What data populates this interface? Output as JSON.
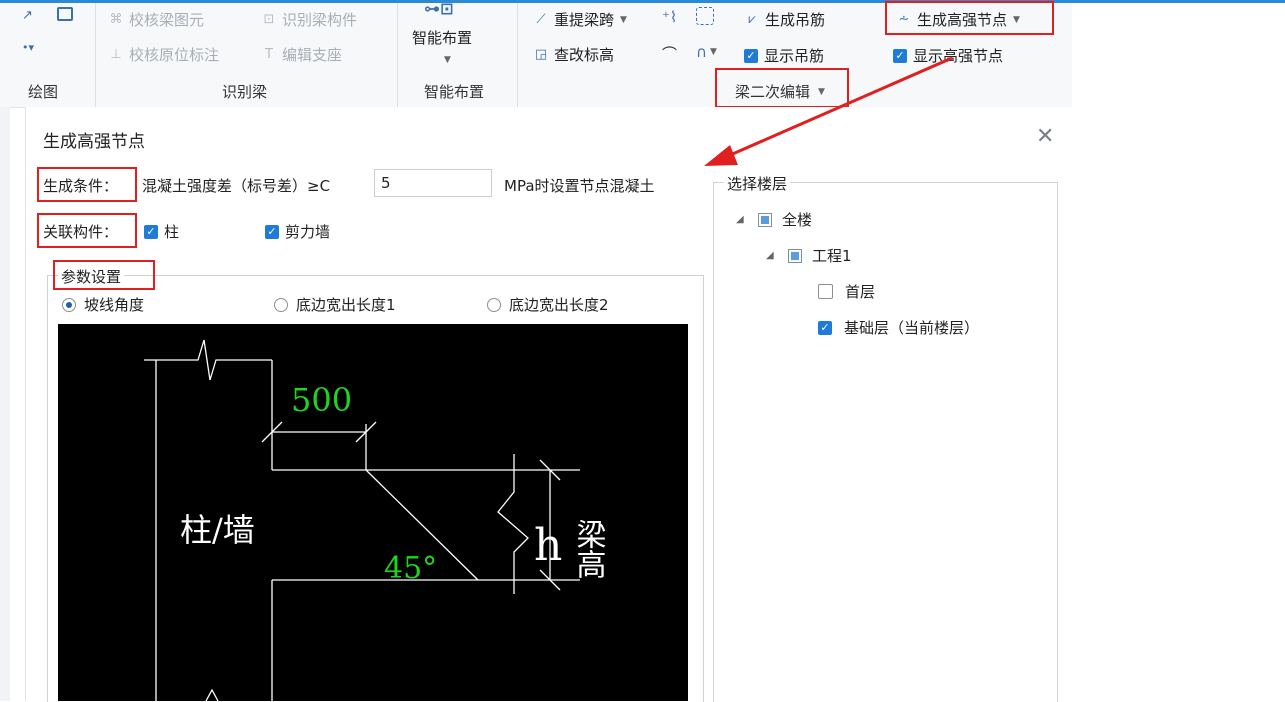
{
  "ribbon": {
    "groups": {
      "draw": "绘图",
      "recognize_beam": "识别梁",
      "smart_layout": "智能布置",
      "beam_secondary_edit": "梁二次编辑"
    },
    "items": {
      "check_beam_elements": "校核梁图元",
      "recognize_beam_members": "识别梁构件",
      "check_original_marks": "校核原位标注",
      "edit_supports": "编辑支座",
      "smart_layout": "智能布置",
      "re_extract_span": "重提梁跨",
      "generate_hanger": "生成吊筋",
      "generate_hs_node": "生成高强节点",
      "modify_elevation": "查改标高",
      "show_hanger": "显示吊筋",
      "show_hs_node": "显示高强节点"
    }
  },
  "dialog": {
    "title": "生成高强节点",
    "condition_label": "生成条件：",
    "condition_text": "混凝土强度差（标号差）≥C",
    "condition_value": "5",
    "condition_suffix": "MPa时设置节点混凝土",
    "related_label": "关联构件：",
    "related_column": "柱",
    "related_shear_wall": "剪力墙",
    "params_legend": "参数设置",
    "radios": {
      "slope_angle": "坡线角度",
      "bottom_ext1": "底边宽出长度1",
      "bottom_ext2": "底边宽出长度2"
    },
    "floors_legend": "选择楼层",
    "tree": {
      "all": "全楼",
      "project": "工程1",
      "first": "首层",
      "foundation": "基础层（当前楼层）"
    },
    "diagram": {
      "dim_500": "500",
      "col_wall": "柱/墙",
      "angle": "45°",
      "h": "h",
      "beam_height": "梁高"
    }
  },
  "colors": {
    "accent": "#1f7ad8",
    "highlight": "#e02020",
    "diagram_bg": "#000000",
    "diagram_green": "#1ed41e"
  }
}
